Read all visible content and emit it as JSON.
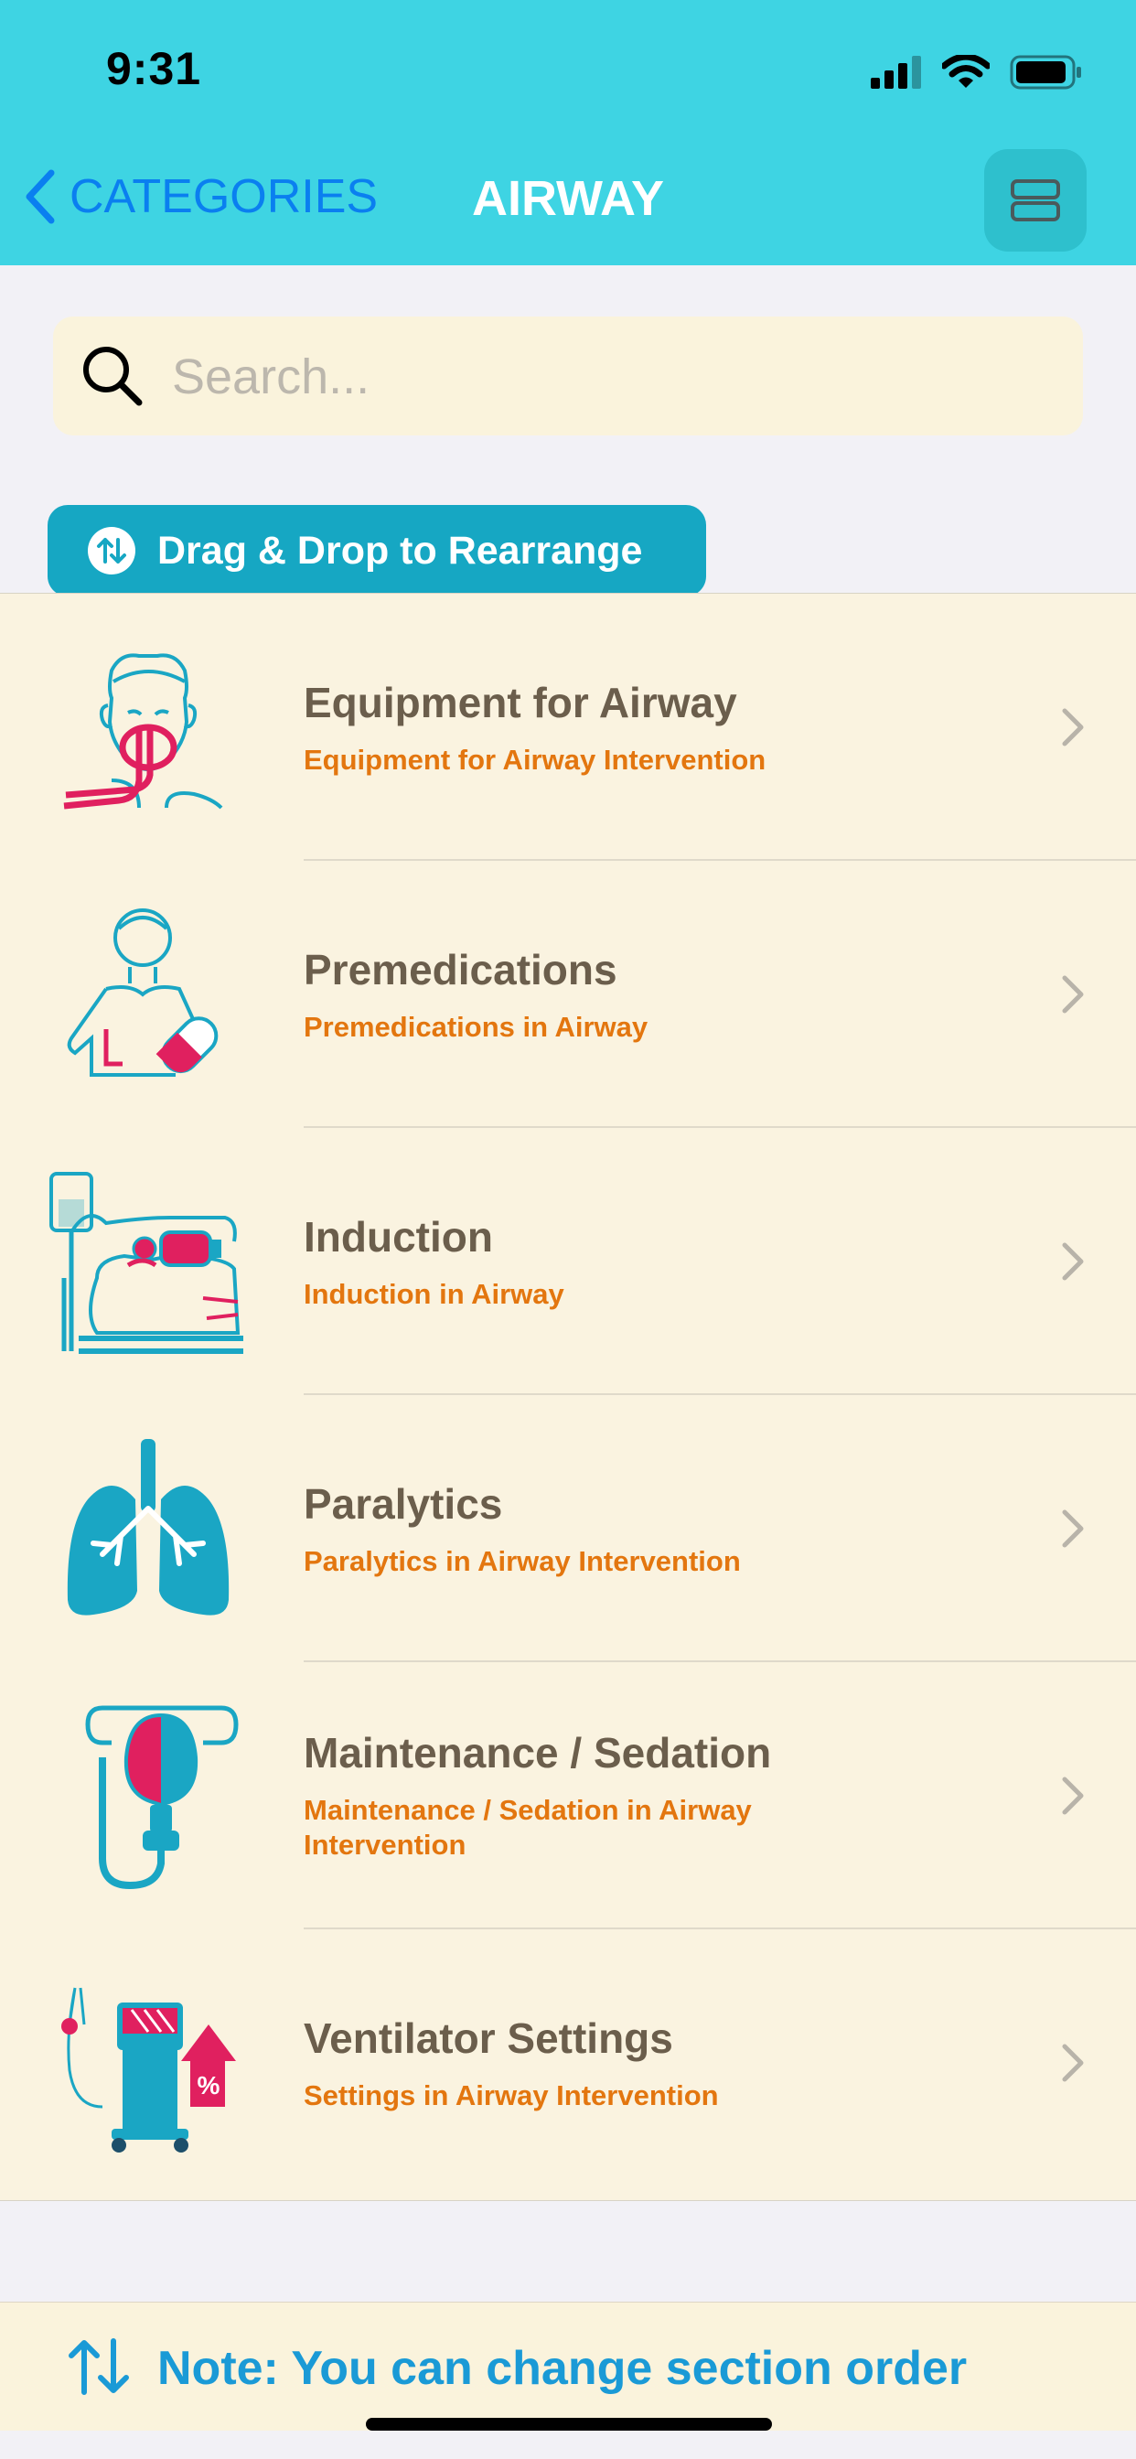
{
  "status": {
    "time": "9:31"
  },
  "nav": {
    "back_label": "CATEGORIES",
    "title": "AIRWAY"
  },
  "search": {
    "placeholder": "Search..."
  },
  "drag_button": {
    "label": "Drag & Drop to Rearrange"
  },
  "items": [
    {
      "title": "Equipment for Airway",
      "subtitle": "Equipment for Airway Intervention",
      "icon": "patient-airway-icon"
    },
    {
      "title": "Premedications",
      "subtitle": "Premedications in Airway",
      "icon": "patient-pill-icon"
    },
    {
      "title": "Induction",
      "subtitle": "Induction in Airway",
      "icon": "iv-stretcher-icon"
    },
    {
      "title": "Paralytics",
      "subtitle": "Paralytics in Airway Intervention",
      "icon": "lungs-icon"
    },
    {
      "title": "Maintenance / Sedation",
      "subtitle": "Maintenance / Sedation in Airway Intervention",
      "icon": "oxygen-mask-icon"
    },
    {
      "title": "Ventilator Settings",
      "subtitle": "Settings in Airway Intervention",
      "icon": "ventilator-icon"
    }
  ],
  "note": {
    "text": "Note: You can change section order"
  },
  "colors": {
    "header": "#3ed4e3",
    "accent": "#16a7c3",
    "title_text": "#6b5e4c",
    "subtitle_text": "#e3760f",
    "list_bg": "#faf3e0",
    "icon_cyan": "#1aa6c4",
    "icon_pink": "#e0205f"
  }
}
